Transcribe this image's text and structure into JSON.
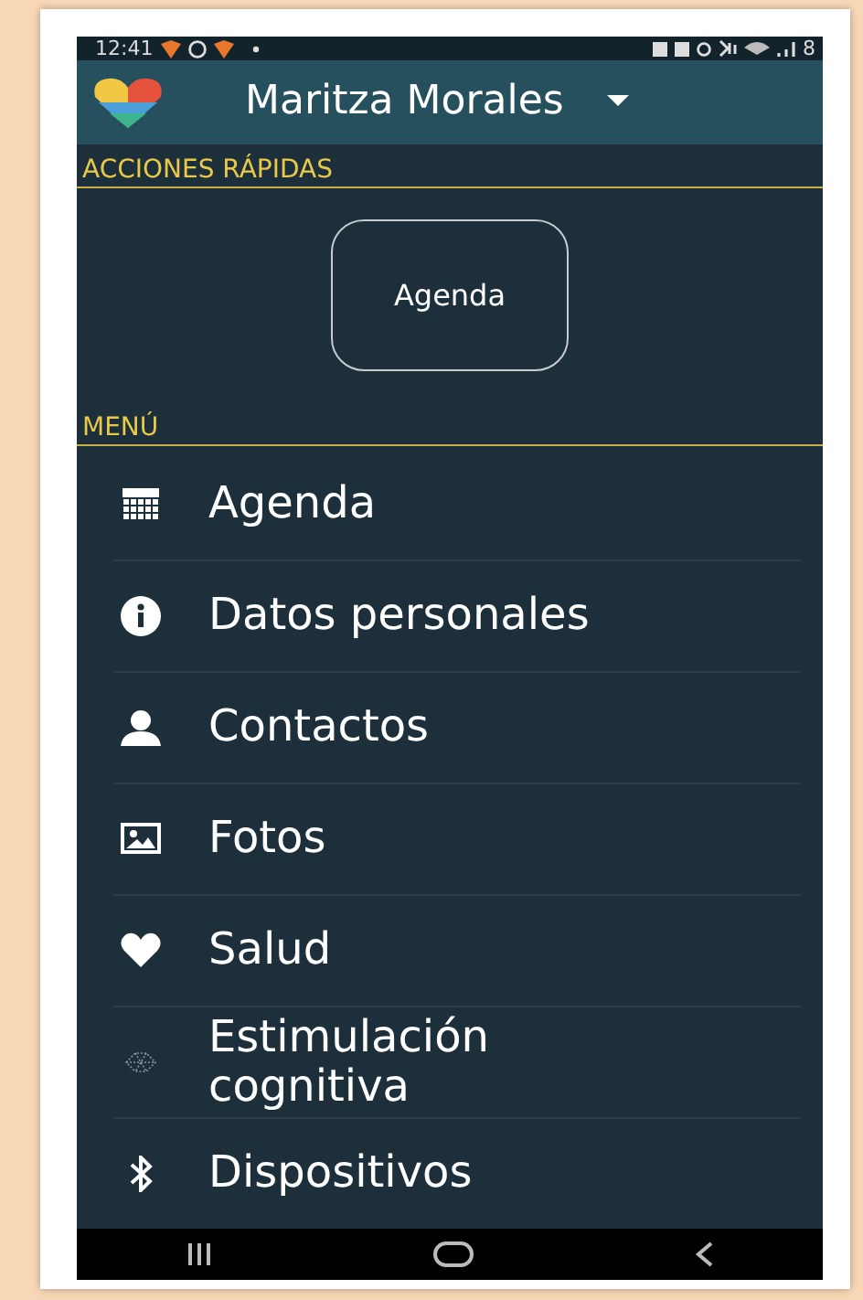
{
  "status_bar": {
    "time": "12:41",
    "battery": "8"
  },
  "header": {
    "user_name": "Maritza Morales"
  },
  "quick_actions": {
    "title": "ACCIONES RÁPIDAS",
    "buttons": [
      "Agenda"
    ]
  },
  "menu": {
    "title": "MENÚ",
    "items": [
      {
        "label": "Agenda"
      },
      {
        "label": "Datos personales"
      },
      {
        "label": "Contactos"
      },
      {
        "label": "Fotos"
      },
      {
        "label": "Salud"
      },
      {
        "label": "Estimulación cognitiva"
      },
      {
        "label": "Dispositivos"
      }
    ]
  }
}
